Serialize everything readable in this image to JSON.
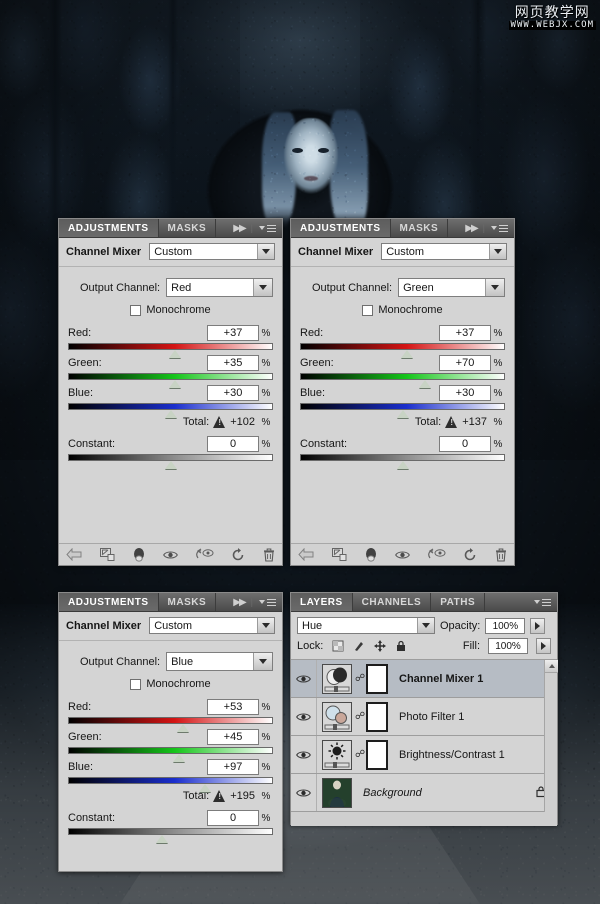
{
  "watermark": {
    "cn": "网页教学网",
    "url": "WWW.WEBJX.COM"
  },
  "common": {
    "tabs": {
      "adjustments": "ADJUSTMENTS",
      "masks": "MASKS"
    },
    "mixer_title": "Channel Mixer",
    "preset_value": "Custom",
    "output_channel_label": "Output Channel:",
    "monochrome_label": "Monochrome",
    "red_label": "Red:",
    "green_label": "Green:",
    "blue_label": "Blue:",
    "total_label": "Total:",
    "constant_label": "Constant:",
    "percent": "%",
    "icons": {
      "collapse": "double-chevron-icon",
      "menu": "panel-menu-icon",
      "back": "back-arrow-icon",
      "clip": "clip-to-layer-icon",
      "bw": "black-white-icon",
      "eye": "eye-icon",
      "preview": "preview-toggle-icon",
      "reset": "reset-icon",
      "trash": "trash-icon",
      "warning": "warning-icon"
    }
  },
  "panels": [
    {
      "id": "channel-mixer-red",
      "output_channel": "Red",
      "red": "+37",
      "green": "+35",
      "blue": "+30",
      "total": "+102",
      "constant": "0",
      "thumb_pct": {
        "red": 52,
        "green": 52,
        "blue": 50,
        "constant": 50
      }
    },
    {
      "id": "channel-mixer-green",
      "output_channel": "Green",
      "red": "+37",
      "green": "+70",
      "blue": "+30",
      "total": "+137",
      "constant": "0",
      "thumb_pct": {
        "red": 52,
        "green": 61,
        "blue": 50,
        "constant": 50
      }
    },
    {
      "id": "channel-mixer-blue",
      "output_channel": "Blue",
      "red": "+53",
      "green": "+45",
      "blue": "+97",
      "total": "+195",
      "constant": "0",
      "thumb_pct": {
        "red": 56,
        "green": 54,
        "blue": 67,
        "constant": 46
      }
    }
  ],
  "layers_panel": {
    "tabs": [
      {
        "label": "LAYERS",
        "active": true
      },
      {
        "label": "CHANNELS",
        "active": false
      },
      {
        "label": "PATHS",
        "active": false
      }
    ],
    "blend_mode": "Hue",
    "opacity_label": "Opacity:",
    "opacity_value": "100%",
    "lock_label": "Lock:",
    "fill_label": "Fill:",
    "fill_value": "100%",
    "lock_icons": [
      "lock-transparency-icon",
      "lock-pixels-icon",
      "lock-position-icon",
      "lock-all-icon"
    ],
    "layers": [
      {
        "name": "Channel Mixer 1",
        "selected": true,
        "style": "bold",
        "kind": "channel-mixer",
        "has_mask": true,
        "locked": false
      },
      {
        "name": "Photo Filter 1",
        "selected": false,
        "style": "plain",
        "kind": "photo-filter",
        "has_mask": true,
        "locked": false
      },
      {
        "name": "Brightness/Contrast 1",
        "selected": false,
        "style": "plain",
        "kind": "brightness-contrast",
        "has_mask": true,
        "locked": false
      },
      {
        "name": "Background",
        "selected": false,
        "style": "italic",
        "kind": "image",
        "has_mask": false,
        "locked": true
      }
    ]
  }
}
